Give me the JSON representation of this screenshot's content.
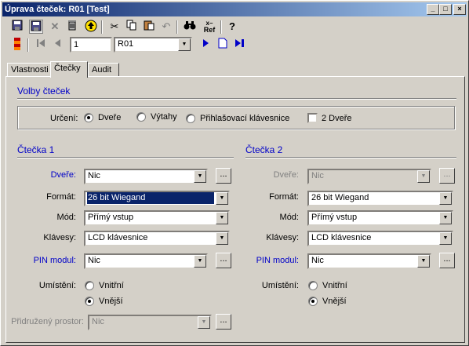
{
  "window": {
    "title": "Úprava čteček: R01 [Test]",
    "controls": [
      "_",
      "□",
      "×"
    ]
  },
  "toolbar2": {
    "record_number": "1",
    "record_select": "R01"
  },
  "tabs": [
    "Vlastnosti",
    "Čtečky",
    "Audit"
  ],
  "options": {
    "heading": "Volby čteček",
    "urceni_label": "Určení:",
    "radio_dvere": "Dveře",
    "radio_vytahy": "Výtahy",
    "radio_klavesnice": "Přihlašovací klávesnice",
    "check_2dvere": "2 Dveře"
  },
  "reader1": {
    "heading": "Čtečka 1",
    "dvere_label": "Dveře:",
    "dvere_value": "Nic",
    "format_label": "Formát:",
    "format_value": "26 bit Wiegand",
    "mod_label": "Mód:",
    "mod_value": "Přímý vstup",
    "klavesy_label": "Klávesy:",
    "klavesy_value": "LCD klávesnice",
    "pin_label": "PIN modul:",
    "pin_value": "Nic",
    "umisteni_label": "Umístění:",
    "vnitrni": "Vnitřní",
    "vnejsi": "Vnější",
    "prostor_label": "Přidružený prostor:",
    "prostor_value": "Nic"
  },
  "reader2": {
    "heading": "Čtečka 2",
    "dvere_label": "Dveře:",
    "dvere_value": "Nic",
    "format_label": "Formát:",
    "format_value": "26 bit Wiegand",
    "mod_label": "Mód:",
    "mod_value": "Přímý vstup",
    "klavesy_label": "Klávesy:",
    "klavesy_value": "LCD klávesnice",
    "pin_label": "PIN modul:",
    "pin_value": "Nic",
    "umisteni_label": "Umístění:",
    "vnitrni": "Vnitřní",
    "vnejsi": "Vnější"
  },
  "ellipsis": "...",
  "icons": {
    "save": "floppy-disk-icon",
    "save_close": "save-close-icon",
    "delete": "delete-x-icon",
    "trash": "trash-icon",
    "up": "up-arrow-icon",
    "cut": "scissors-icon",
    "copy": "copy-icon",
    "paste": "paste-icon",
    "undo": "undo-icon",
    "find": "binoculars-icon",
    "ref": "ref-icon",
    "help": "help-icon"
  },
  "ref_label": "Ref",
  "colors": {
    "title_start": "#0a246a",
    "title_end": "#a6caf0",
    "label_blue": "#0000c8",
    "face": "#d4d0c8"
  }
}
